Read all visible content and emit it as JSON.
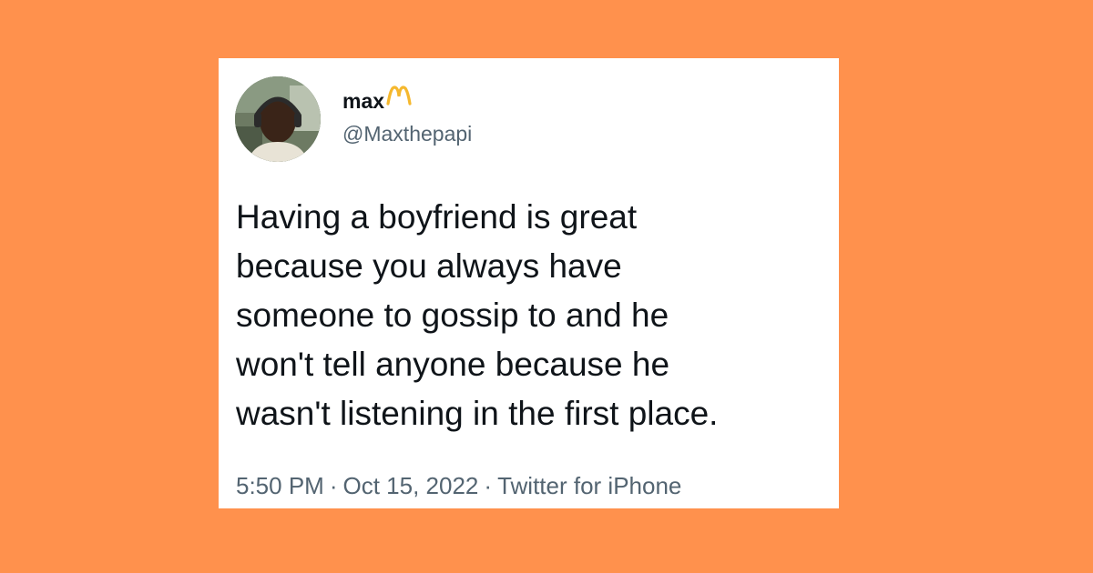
{
  "colors": {
    "background": "#FF914D",
    "card": "#FFFFFF",
    "text_primary": "#0F1419",
    "text_secondary": "#536471",
    "emoji_accent": "#F5B82E"
  },
  "tweet": {
    "author": {
      "display_name": "max",
      "name_emoji": "golden-arches-icon",
      "handle": "@Maxthepapi",
      "avatar": "profile-photo"
    },
    "text": "Having a boyfriend is great\nbecause you always have\nsomeone to gossip to and he\nwon't tell anyone because he\nwasn't listening in the first place.",
    "time": "5:50 PM",
    "date": "Oct 15, 2022",
    "source": "Twitter for iPhone",
    "separator": "·"
  }
}
